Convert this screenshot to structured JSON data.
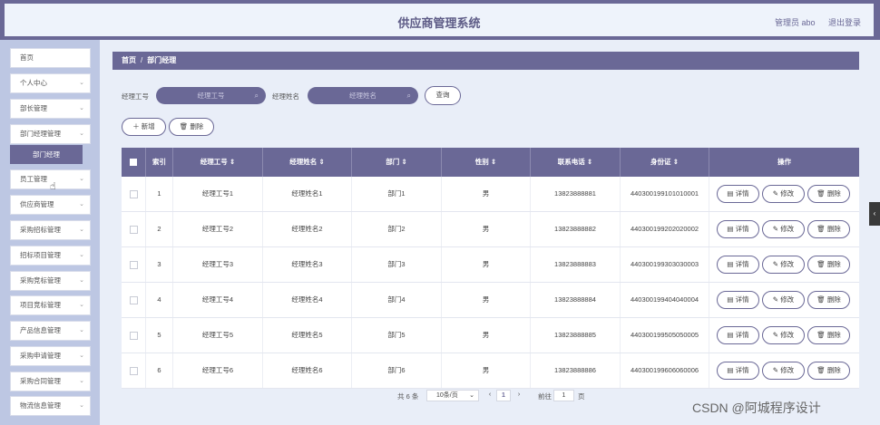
{
  "header": {
    "title": "供应商管理系统",
    "user_label": "管理员 abo",
    "logout_label": "退出登录"
  },
  "sidebar": {
    "items": [
      {
        "label": "首页",
        "expandable": false
      },
      {
        "label": "个人中心",
        "expandable": true
      },
      {
        "label": "部长管理",
        "expandable": true
      },
      {
        "label": "部门经理管理",
        "expandable": true
      },
      {
        "label": "员工管理",
        "expandable": true
      },
      {
        "label": "供应商管理",
        "expandable": true
      },
      {
        "label": "采购招标管理",
        "expandable": true
      },
      {
        "label": "招标项目管理",
        "expandable": true
      },
      {
        "label": "采购竞标管理",
        "expandable": true
      },
      {
        "label": "项目竞标管理",
        "expandable": true
      },
      {
        "label": "产品信息管理",
        "expandable": true
      },
      {
        "label": "采购申请管理",
        "expandable": true
      },
      {
        "label": "采购合同管理",
        "expandable": true
      },
      {
        "label": "物流信息管理",
        "expandable": true
      }
    ],
    "active_sub": "部门经理"
  },
  "breadcrumb": {
    "home": "首页",
    "separator": "/",
    "current": "部门经理"
  },
  "search": {
    "field1_label": "经理工号",
    "field1_placeholder": "经理工号",
    "field2_label": "经理姓名",
    "field2_placeholder": "经理姓名",
    "query_button": "查询"
  },
  "actions": {
    "add_label": "新增",
    "delete_label": "删除"
  },
  "table": {
    "columns": [
      "索引",
      "经理工号",
      "经理姓名",
      "部门",
      "性别",
      "联系电话",
      "身份证",
      "操作"
    ],
    "row_actions": {
      "detail": "详情",
      "edit": "修改",
      "delete": "删除"
    },
    "rows": [
      [
        "1",
        "经理工号1",
        "经理姓名1",
        "部门1",
        "男",
        "13823888881",
        "440300199101010001"
      ],
      [
        "2",
        "经理工号2",
        "经理姓名2",
        "部门2",
        "男",
        "13823888882",
        "440300199202020002"
      ],
      [
        "3",
        "经理工号3",
        "经理姓名3",
        "部门3",
        "男",
        "13823888883",
        "440300199303030003"
      ],
      [
        "4",
        "经理工号4",
        "经理姓名4",
        "部门4",
        "男",
        "13823888884",
        "440300199404040004"
      ],
      [
        "5",
        "经理工号5",
        "经理姓名5",
        "部门5",
        "男",
        "13823888885",
        "440300199505050005"
      ],
      [
        "6",
        "经理工号6",
        "经理姓名6",
        "部门6",
        "男",
        "13823888886",
        "440300199606060006"
      ]
    ]
  },
  "pagination": {
    "total": "共 6 条",
    "page_size": "10条/页",
    "current_page": "1",
    "goto_label": "前往",
    "goto_value": "1",
    "page_unit": "页"
  },
  "watermark": "CSDN @阿城程序设计",
  "colors": {
    "primary": "#6a6896",
    "sidebar_bg": "#bdc7e3",
    "main_bg": "#e9eef8"
  }
}
